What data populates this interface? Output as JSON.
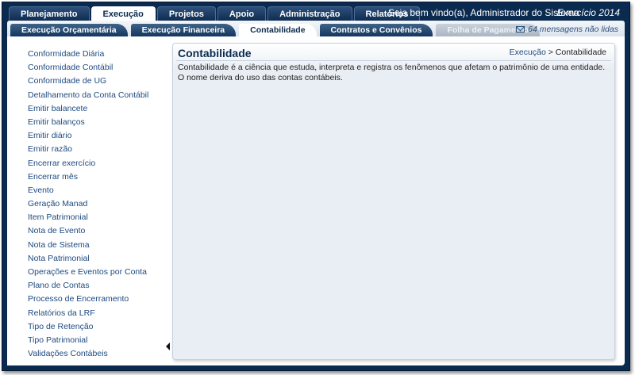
{
  "top_tabs": [
    {
      "label": "Planejamento"
    },
    {
      "label": "Execução"
    },
    {
      "label": "Projetos"
    },
    {
      "label": "Apoio"
    },
    {
      "label": "Administração"
    },
    {
      "label": "Relatórios"
    }
  ],
  "header": {
    "welcome": "Seja bem vindo(a), Administrador do Sistema",
    "exercicio": "Exercício 2014",
    "messages": "64 mensagens não lidas"
  },
  "sub_tabs": [
    {
      "label": "Execução Orçamentária"
    },
    {
      "label": "Execução Financeira"
    },
    {
      "label": "Contabilidade"
    },
    {
      "label": "Contratos e Convênios"
    },
    {
      "label": "Folha de Pagamento"
    }
  ],
  "sidebar": {
    "items": [
      {
        "label": "Conformidade Diária"
      },
      {
        "label": "Conformidade Contábil"
      },
      {
        "label": "Conformidade de UG"
      },
      {
        "label": "Detalhamento da Conta Contábil"
      },
      {
        "label": "Emitir balancete"
      },
      {
        "label": "Emitir balanços"
      },
      {
        "label": "Emitir diário"
      },
      {
        "label": "Emitir razão"
      },
      {
        "label": "Encerrar exercício"
      },
      {
        "label": "Encerrar mês"
      },
      {
        "label": "Evento"
      },
      {
        "label": "Geração Manad"
      },
      {
        "label": "Item Patrimonial"
      },
      {
        "label": "Nota de Evento"
      },
      {
        "label": "Nota de Sistema"
      },
      {
        "label": "Nota Patrimonial"
      },
      {
        "label": "Operações e Eventos por Conta"
      },
      {
        "label": "Plano de Contas"
      },
      {
        "label": "Processo de Encerramento"
      },
      {
        "label": "Relatórios da LRF"
      },
      {
        "label": "Tipo de Retenção"
      },
      {
        "label": "Tipo Patrimonial"
      },
      {
        "label": "Validações Contábeis"
      }
    ]
  },
  "main": {
    "title": "Contabilidade",
    "breadcrumb": {
      "parent": "Execução",
      "separator": ">",
      "current": "Contabilidade"
    },
    "description": "Contabilidade é a ciência que estuda, interpreta e registra os fenômenos que afetam o patrimônio de uma entidade. O nome deriva do uso das contas contábeis."
  },
  "icons": {
    "messages": "envelope-icon",
    "collapse": "collapse-left-arrow-icon"
  },
  "colors": {
    "header_bg": "#0b2a4f",
    "link": "#1d4a80",
    "panel_bg": "#e9eef4"
  }
}
